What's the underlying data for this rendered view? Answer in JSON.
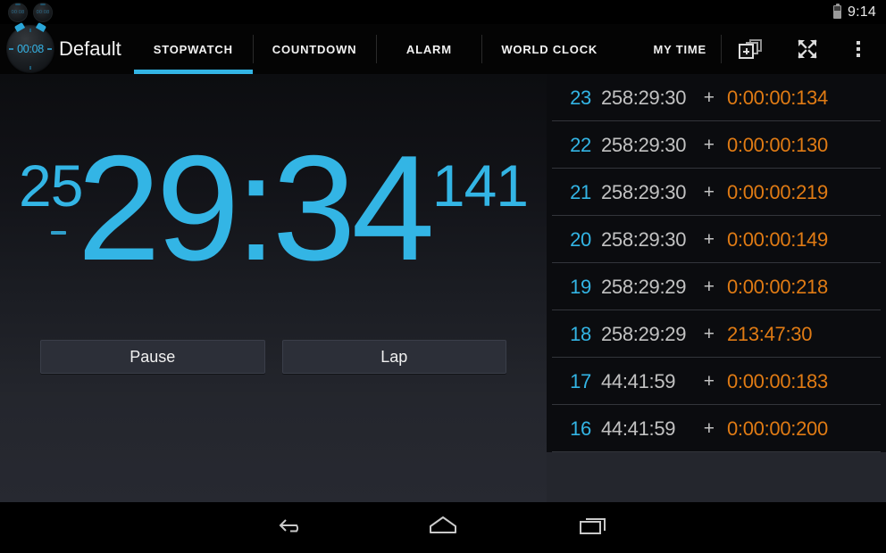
{
  "statusbar": {
    "notification_icons": [
      "stopwatch-notification-icon",
      "stopwatch-notification-icon"
    ],
    "notification_label": "00:08",
    "battery_icon": "battery-icon",
    "clock": "9:14"
  },
  "actionbar": {
    "app_icon": "stopwatch-app-icon",
    "app_icon_face": "00:08",
    "title": "Default",
    "tabs": [
      {
        "label": "STOPWATCH",
        "active": true
      },
      {
        "label": "COUNTDOWN",
        "active": false
      },
      {
        "label": "ALARM",
        "active": false
      },
      {
        "label": "WORLD CLOCK",
        "active": false
      }
    ],
    "my_time_label": "MY TIME",
    "actions": [
      {
        "name": "add-card-icon",
        "label": "add-card"
      },
      {
        "name": "fullscreen-icon",
        "label": "fullscreen"
      },
      {
        "name": "overflow-menu-icon",
        "label": "more options"
      }
    ]
  },
  "stopwatch": {
    "prefix": "25",
    "time": "29:34",
    "suffix": "141",
    "buttons": [
      {
        "label": "Pause",
        "name": "pause-button"
      },
      {
        "label": "Lap",
        "name": "lap-button"
      }
    ]
  },
  "laps": {
    "plus_symbol": "+",
    "rows": [
      {
        "num": "23",
        "total": "258:29:30",
        "split": "0:00:00:134"
      },
      {
        "num": "22",
        "total": "258:29:30",
        "split": "0:00:00:130"
      },
      {
        "num": "21",
        "total": "258:29:30",
        "split": "0:00:00:219"
      },
      {
        "num": "20",
        "total": "258:29:30",
        "split": "0:00:00:149"
      },
      {
        "num": "19",
        "total": "258:29:29",
        "split": "0:00:00:218"
      },
      {
        "num": "18",
        "total": "258:29:29",
        "split": "213:47:30"
      },
      {
        "num": "17",
        "total": "44:41:59",
        "split": "0:00:00:183"
      },
      {
        "num": "16",
        "total": "44:41:59",
        "split": "0:00:00:200"
      }
    ]
  },
  "navbar": {
    "buttons": [
      {
        "name": "back-button",
        "icon": "back-icon"
      },
      {
        "name": "home-button",
        "icon": "home-icon"
      },
      {
        "name": "recents-button",
        "icon": "recents-icon"
      }
    ]
  },
  "colors": {
    "accent_blue": "#33b5e5",
    "split_orange": "#e07b14",
    "panel_dark": "#24262d",
    "list_bg": "#0b0c0f"
  }
}
